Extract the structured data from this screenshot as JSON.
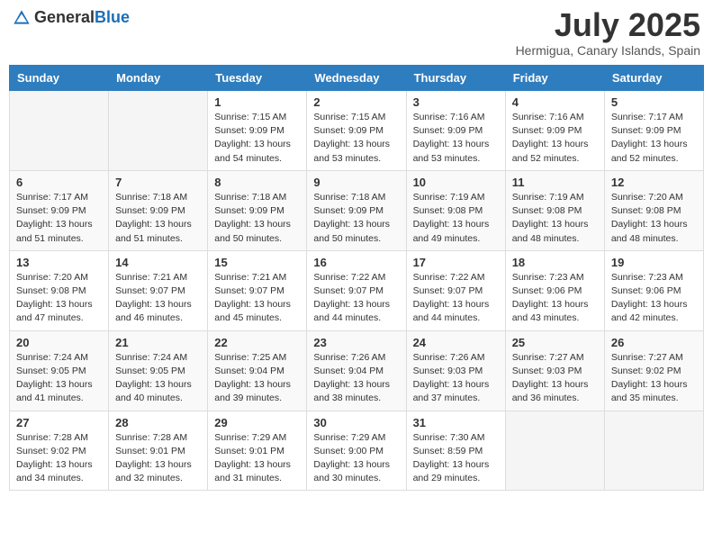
{
  "header": {
    "logo_general": "General",
    "logo_blue": "Blue",
    "month_year": "July 2025",
    "location": "Hermigua, Canary Islands, Spain"
  },
  "days_of_week": [
    "Sunday",
    "Monday",
    "Tuesday",
    "Wednesday",
    "Thursday",
    "Friday",
    "Saturday"
  ],
  "weeks": [
    [
      {
        "day": "",
        "info": ""
      },
      {
        "day": "",
        "info": ""
      },
      {
        "day": "1",
        "info": "Sunrise: 7:15 AM\nSunset: 9:09 PM\nDaylight: 13 hours and 54 minutes."
      },
      {
        "day": "2",
        "info": "Sunrise: 7:15 AM\nSunset: 9:09 PM\nDaylight: 13 hours and 53 minutes."
      },
      {
        "day": "3",
        "info": "Sunrise: 7:16 AM\nSunset: 9:09 PM\nDaylight: 13 hours and 53 minutes."
      },
      {
        "day": "4",
        "info": "Sunrise: 7:16 AM\nSunset: 9:09 PM\nDaylight: 13 hours and 52 minutes."
      },
      {
        "day": "5",
        "info": "Sunrise: 7:17 AM\nSunset: 9:09 PM\nDaylight: 13 hours and 52 minutes."
      }
    ],
    [
      {
        "day": "6",
        "info": "Sunrise: 7:17 AM\nSunset: 9:09 PM\nDaylight: 13 hours and 51 minutes."
      },
      {
        "day": "7",
        "info": "Sunrise: 7:18 AM\nSunset: 9:09 PM\nDaylight: 13 hours and 51 minutes."
      },
      {
        "day": "8",
        "info": "Sunrise: 7:18 AM\nSunset: 9:09 PM\nDaylight: 13 hours and 50 minutes."
      },
      {
        "day": "9",
        "info": "Sunrise: 7:18 AM\nSunset: 9:09 PM\nDaylight: 13 hours and 50 minutes."
      },
      {
        "day": "10",
        "info": "Sunrise: 7:19 AM\nSunset: 9:08 PM\nDaylight: 13 hours and 49 minutes."
      },
      {
        "day": "11",
        "info": "Sunrise: 7:19 AM\nSunset: 9:08 PM\nDaylight: 13 hours and 48 minutes."
      },
      {
        "day": "12",
        "info": "Sunrise: 7:20 AM\nSunset: 9:08 PM\nDaylight: 13 hours and 48 minutes."
      }
    ],
    [
      {
        "day": "13",
        "info": "Sunrise: 7:20 AM\nSunset: 9:08 PM\nDaylight: 13 hours and 47 minutes."
      },
      {
        "day": "14",
        "info": "Sunrise: 7:21 AM\nSunset: 9:07 PM\nDaylight: 13 hours and 46 minutes."
      },
      {
        "day": "15",
        "info": "Sunrise: 7:21 AM\nSunset: 9:07 PM\nDaylight: 13 hours and 45 minutes."
      },
      {
        "day": "16",
        "info": "Sunrise: 7:22 AM\nSunset: 9:07 PM\nDaylight: 13 hours and 44 minutes."
      },
      {
        "day": "17",
        "info": "Sunrise: 7:22 AM\nSunset: 9:07 PM\nDaylight: 13 hours and 44 minutes."
      },
      {
        "day": "18",
        "info": "Sunrise: 7:23 AM\nSunset: 9:06 PM\nDaylight: 13 hours and 43 minutes."
      },
      {
        "day": "19",
        "info": "Sunrise: 7:23 AM\nSunset: 9:06 PM\nDaylight: 13 hours and 42 minutes."
      }
    ],
    [
      {
        "day": "20",
        "info": "Sunrise: 7:24 AM\nSunset: 9:05 PM\nDaylight: 13 hours and 41 minutes."
      },
      {
        "day": "21",
        "info": "Sunrise: 7:24 AM\nSunset: 9:05 PM\nDaylight: 13 hours and 40 minutes."
      },
      {
        "day": "22",
        "info": "Sunrise: 7:25 AM\nSunset: 9:04 PM\nDaylight: 13 hours and 39 minutes."
      },
      {
        "day": "23",
        "info": "Sunrise: 7:26 AM\nSunset: 9:04 PM\nDaylight: 13 hours and 38 minutes."
      },
      {
        "day": "24",
        "info": "Sunrise: 7:26 AM\nSunset: 9:03 PM\nDaylight: 13 hours and 37 minutes."
      },
      {
        "day": "25",
        "info": "Sunrise: 7:27 AM\nSunset: 9:03 PM\nDaylight: 13 hours and 36 minutes."
      },
      {
        "day": "26",
        "info": "Sunrise: 7:27 AM\nSunset: 9:02 PM\nDaylight: 13 hours and 35 minutes."
      }
    ],
    [
      {
        "day": "27",
        "info": "Sunrise: 7:28 AM\nSunset: 9:02 PM\nDaylight: 13 hours and 34 minutes."
      },
      {
        "day": "28",
        "info": "Sunrise: 7:28 AM\nSunset: 9:01 PM\nDaylight: 13 hours and 32 minutes."
      },
      {
        "day": "29",
        "info": "Sunrise: 7:29 AM\nSunset: 9:01 PM\nDaylight: 13 hours and 31 minutes."
      },
      {
        "day": "30",
        "info": "Sunrise: 7:29 AM\nSunset: 9:00 PM\nDaylight: 13 hours and 30 minutes."
      },
      {
        "day": "31",
        "info": "Sunrise: 7:30 AM\nSunset: 8:59 PM\nDaylight: 13 hours and 29 minutes."
      },
      {
        "day": "",
        "info": ""
      },
      {
        "day": "",
        "info": ""
      }
    ]
  ]
}
